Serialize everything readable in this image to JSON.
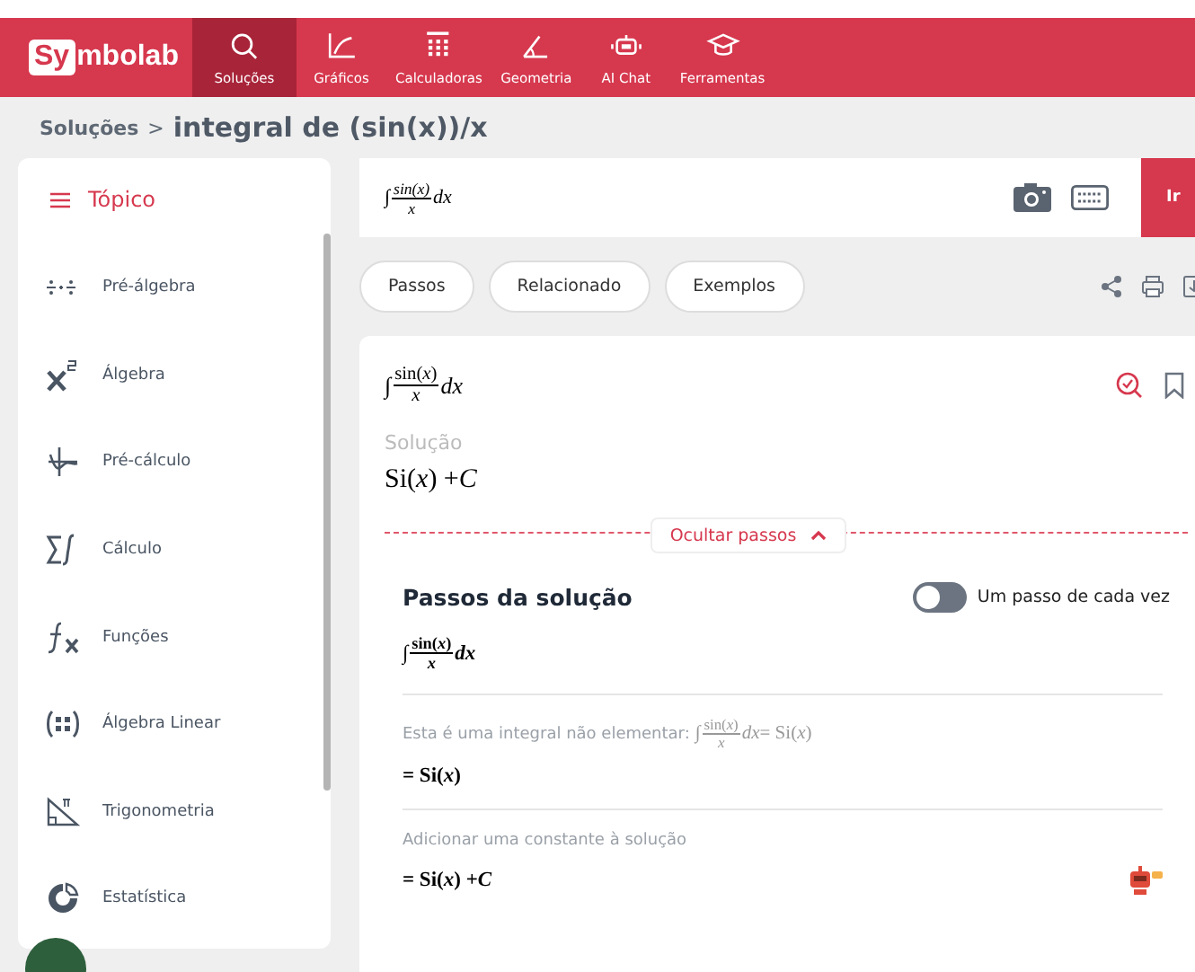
{
  "header": {
    "logo": {
      "boxed": "Sy",
      "rest": "mbolab"
    },
    "nav": [
      {
        "label": "Soluções",
        "selected": true
      },
      {
        "label": "Gráficos",
        "selected": false
      },
      {
        "label": "Calculadoras",
        "selected": false
      },
      {
        "label": "Geometria",
        "selected": false
      },
      {
        "label": "AI Chat",
        "selected": false
      },
      {
        "label": "Ferramentas",
        "selected": false
      }
    ]
  },
  "breadcrumb": {
    "parent": "Soluções",
    "separator": ">",
    "current": "integral de (sin(x))/x"
  },
  "sidebar": {
    "title": "Tópico",
    "items": [
      {
        "label": "Pré-álgebra"
      },
      {
        "label": "Álgebra"
      },
      {
        "label": "Pré-cálculo"
      },
      {
        "label": "Cálculo"
      },
      {
        "label": "Funções"
      },
      {
        "label": "Álgebra Linear"
      },
      {
        "label": "Trigonometria"
      },
      {
        "label": "Estatística"
      }
    ]
  },
  "input": {
    "math": [
      {
        "kind": "rm",
        "text": "∫"
      },
      {
        "kind": "frac",
        "num": [
          {
            "kind": "it",
            "text": "sin(x)"
          }
        ],
        "den": [
          {
            "kind": "it",
            "text": "x"
          }
        ]
      },
      {
        "kind": "it",
        "text": "dx"
      }
    ],
    "go": "Ir"
  },
  "tabs": [
    "Passos",
    "Relacionado",
    "Exemplos"
  ],
  "result": {
    "problem": [
      {
        "kind": "rm",
        "text": "∫ "
      },
      {
        "kind": "frac",
        "num": [
          {
            "kind": "rm",
            "text": "sin("
          },
          {
            "kind": "it",
            "text": "x"
          },
          {
            "kind": "rm",
            "text": ")"
          }
        ],
        "den": [
          {
            "kind": "it",
            "text": "x"
          }
        ]
      },
      {
        "kind": "it",
        "text": "dx"
      }
    ],
    "solution_label": "Solução",
    "solution": [
      {
        "kind": "rm",
        "text": "Si("
      },
      {
        "kind": "it",
        "text": "x"
      },
      {
        "kind": "rm",
        "text": ") + "
      },
      {
        "kind": "it",
        "text": "C"
      }
    ],
    "hide_steps": "Ocultar passos"
  },
  "steps": {
    "title": "Passos da solução",
    "toggle": {
      "label": "Um passo de cada vez",
      "on": false
    },
    "items": [
      {
        "math": [
          {
            "kind": "rm",
            "text": "∫ "
          },
          {
            "kind": "frac",
            "num": [
              {
                "kind": "rm",
                "text": "sin("
              },
              {
                "kind": "it",
                "text": "x"
              },
              {
                "kind": "rm",
                "text": ")"
              }
            ],
            "den": [
              {
                "kind": "it",
                "text": "x"
              }
            ]
          },
          {
            "kind": "it",
            "text": "dx"
          }
        ]
      },
      {
        "note": "Esta é uma integral não elementar:",
        "note_math": [
          {
            "kind": "rm",
            "text": "∫ "
          },
          {
            "kind": "frac",
            "num": [
              {
                "kind": "rm",
                "text": "sin("
              },
              {
                "kind": "it",
                "text": "x"
              },
              {
                "kind": "rm",
                "text": ")"
              }
            ],
            "den": [
              {
                "kind": "it",
                "text": "x"
              }
            ]
          },
          {
            "kind": "it",
            "text": "dx"
          },
          {
            "kind": "rm",
            "text": " = Si("
          },
          {
            "kind": "it",
            "text": "x"
          },
          {
            "kind": "rm",
            "text": ")"
          }
        ],
        "math": [
          {
            "kind": "rm",
            "text": "= Si("
          },
          {
            "kind": "it",
            "text": "x"
          },
          {
            "kind": "rm",
            "text": ")"
          }
        ]
      },
      {
        "note": "Adicionar uma constante à solução",
        "math": [
          {
            "kind": "rm",
            "text": "= Si("
          },
          {
            "kind": "it",
            "text": "x"
          },
          {
            "kind": "rm",
            "text": ") + "
          },
          {
            "kind": "it",
            "text": "C"
          }
        ]
      }
    ]
  }
}
